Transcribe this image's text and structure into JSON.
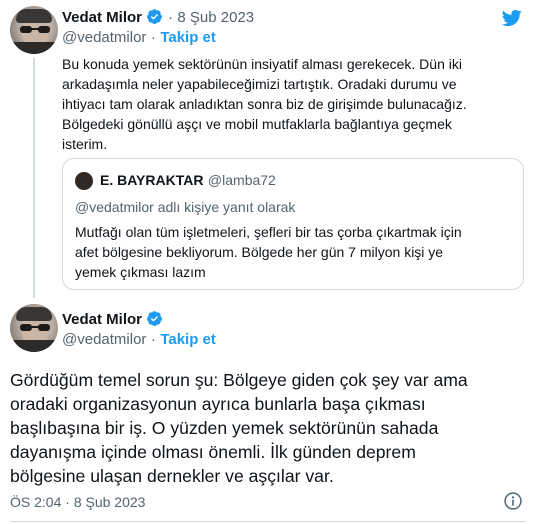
{
  "tweet1": {
    "name": "Vedat Milor",
    "handle": "@vedatmilor",
    "follow_label": "Takip et",
    "separator": "·",
    "date": "8 Şub 2023",
    "text_lines": [
      "Bu konuda yemek sektörünün insiyatif alması gerekecek. Dün iki",
      "arkadaşımla neler yapabileceğimizi tartıştık. Oradaki durumu ve",
      "ihtiyacı tam olarak anladıktan sonra biz de girişimde bulunacağız.",
      "Bölgedeki gönüllü aşçı ve mobil mutfaklarla bağlantıya geçmek",
      "isterim."
    ]
  },
  "quote": {
    "name": "E. BAYRAKTAR",
    "handle": "@lamba72",
    "reply_to": "@vedatmilor adlı kişiye yanıt olarak",
    "text_lines": [
      "Mutfağı olan tüm işletmeleri, şefleri bir tas çorba çıkartmak için",
      "afet bölgesine bekliyorum. Bölgede her gün 7 milyon kişi ye",
      "yemek çıkması lazım"
    ]
  },
  "tweet2": {
    "name": "Vedat Milor",
    "handle": "@vedatmilor",
    "separator": "·",
    "follow_label": "Takip et",
    "text_lines": [
      "Gördüğüm temel sorun şu: Bölgeye giden çok şey var ama",
      "oradaki organizasyonun ayrıca bunlarla başa çıkması",
      "başlıbaşına bir iş. O yüzden yemek sektörünün sahada",
      "dayanışma içinde olması önemli. İlk günden deprem",
      "bölgesine ulaşan dernekler ve aşçılar var."
    ],
    "time": "ÖS 2:04",
    "date": "8 Şub 2023"
  },
  "colors": {
    "accent": "#1d9bf0",
    "text": "#0f1419",
    "muted": "#536471",
    "border": "#cfd9de"
  },
  "icons": {
    "brand": "twitter-bird-icon",
    "verified": "verified-badge-icon",
    "info": "info-icon"
  }
}
